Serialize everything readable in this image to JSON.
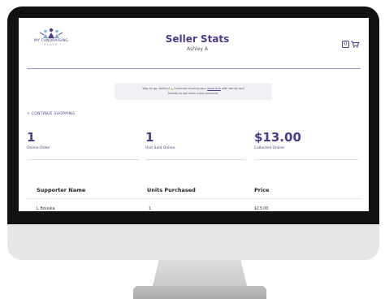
{
  "header": {
    "logo_line1": "MY FUNDRAISING",
    "logo_line2": "PLACE",
    "title": "Seller Stats",
    "seller_name": "Ashley A",
    "cart_count": "0"
  },
  "banner": {
    "line1_a": "Way to go, Ashley! ",
    "line1_b": " Continue sharing your ",
    "line1_link": "store link",
    "line1_c": " with family and",
    "line2": "friends to sell even more products."
  },
  "nav": {
    "continue_shopping": "< CONTINUE SHOPPING"
  },
  "stats": [
    {
      "value": "1",
      "label": "Online Order"
    },
    {
      "value": "1",
      "label": "Unit Sold Online"
    },
    {
      "value": "$13.00",
      "label": "Collected Online"
    }
  ],
  "table": {
    "headers": [
      "Supporter Name",
      "Units Purchased",
      "Price"
    ],
    "rows": [
      [
        "L Bouska",
        "1",
        "$13.00"
      ]
    ]
  },
  "colors": {
    "brand": "#4c3a8c",
    "bezel": "#111111"
  },
  "icons": [
    "logo-people-icon",
    "cart-icon"
  ]
}
